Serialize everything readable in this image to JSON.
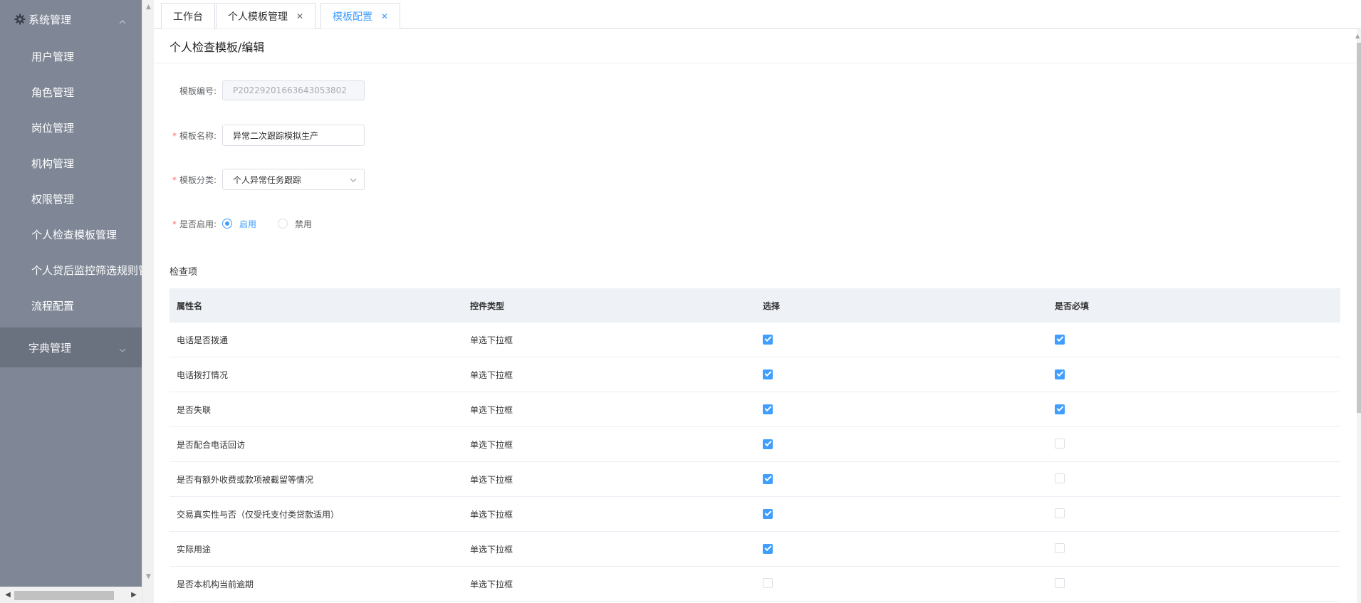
{
  "sidebar": {
    "group_title": "系统管理",
    "items": [
      {
        "label": "用户管理"
      },
      {
        "label": "角色管理"
      },
      {
        "label": "岗位管理"
      },
      {
        "label": "机构管理"
      },
      {
        "label": "权限管理"
      },
      {
        "label": "个人检查模板管理"
      },
      {
        "label": "个人贷后监控筛选规则管"
      },
      {
        "label": "流程配置"
      }
    ],
    "dict_group": "字典管理"
  },
  "tabs": [
    {
      "label": "工作台",
      "closable": false,
      "active": false
    },
    {
      "label": "个人模板管理",
      "closable": true,
      "active": false
    },
    {
      "label": "模板配置",
      "closable": true,
      "active": true
    }
  ],
  "page": {
    "title": "个人检查模板/编辑"
  },
  "form": {
    "code_label": "模板编号:",
    "code_value": "P202292016636430538​02",
    "name_label": "模板名称:",
    "name_value": "异常二次跟踪模拟生产",
    "category_label": "模板分类:",
    "category_value": "个人异常任务跟踪",
    "enabled_label": "是否启用:",
    "enabled_on": "启用",
    "enabled_off": "禁用",
    "enabled": true
  },
  "section": {
    "title": "检查项"
  },
  "table": {
    "headers": [
      "属性名",
      "控件类型",
      "选择",
      "是否必填"
    ],
    "rows": [
      {
        "name": "电话是否拨通",
        "type": "单选下拉框",
        "selected": true,
        "required": true
      },
      {
        "name": "电话拨打情况",
        "type": "单选下拉框",
        "selected": true,
        "required": true
      },
      {
        "name": "是否失联",
        "type": "单选下拉框",
        "selected": true,
        "required": true
      },
      {
        "name": "是否配合电话回访",
        "type": "单选下拉框",
        "selected": true,
        "required": false
      },
      {
        "name": "是否有额外收费或款项被截留等情况",
        "type": "单选下拉框",
        "selected": true,
        "required": false
      },
      {
        "name": "交易真实性与否（仅受托支付类贷款适用）",
        "type": "单选下拉框",
        "selected": true,
        "required": false
      },
      {
        "name": "实际用途",
        "type": "单选下拉框",
        "selected": true,
        "required": false
      },
      {
        "name": "是否本机构当前逾期",
        "type": "单选下拉框",
        "selected": false,
        "required": false
      }
    ]
  },
  "colors": {
    "sidebar_bg": "#7f8796",
    "accent": "#409eff",
    "required": "#f56c6c"
  }
}
